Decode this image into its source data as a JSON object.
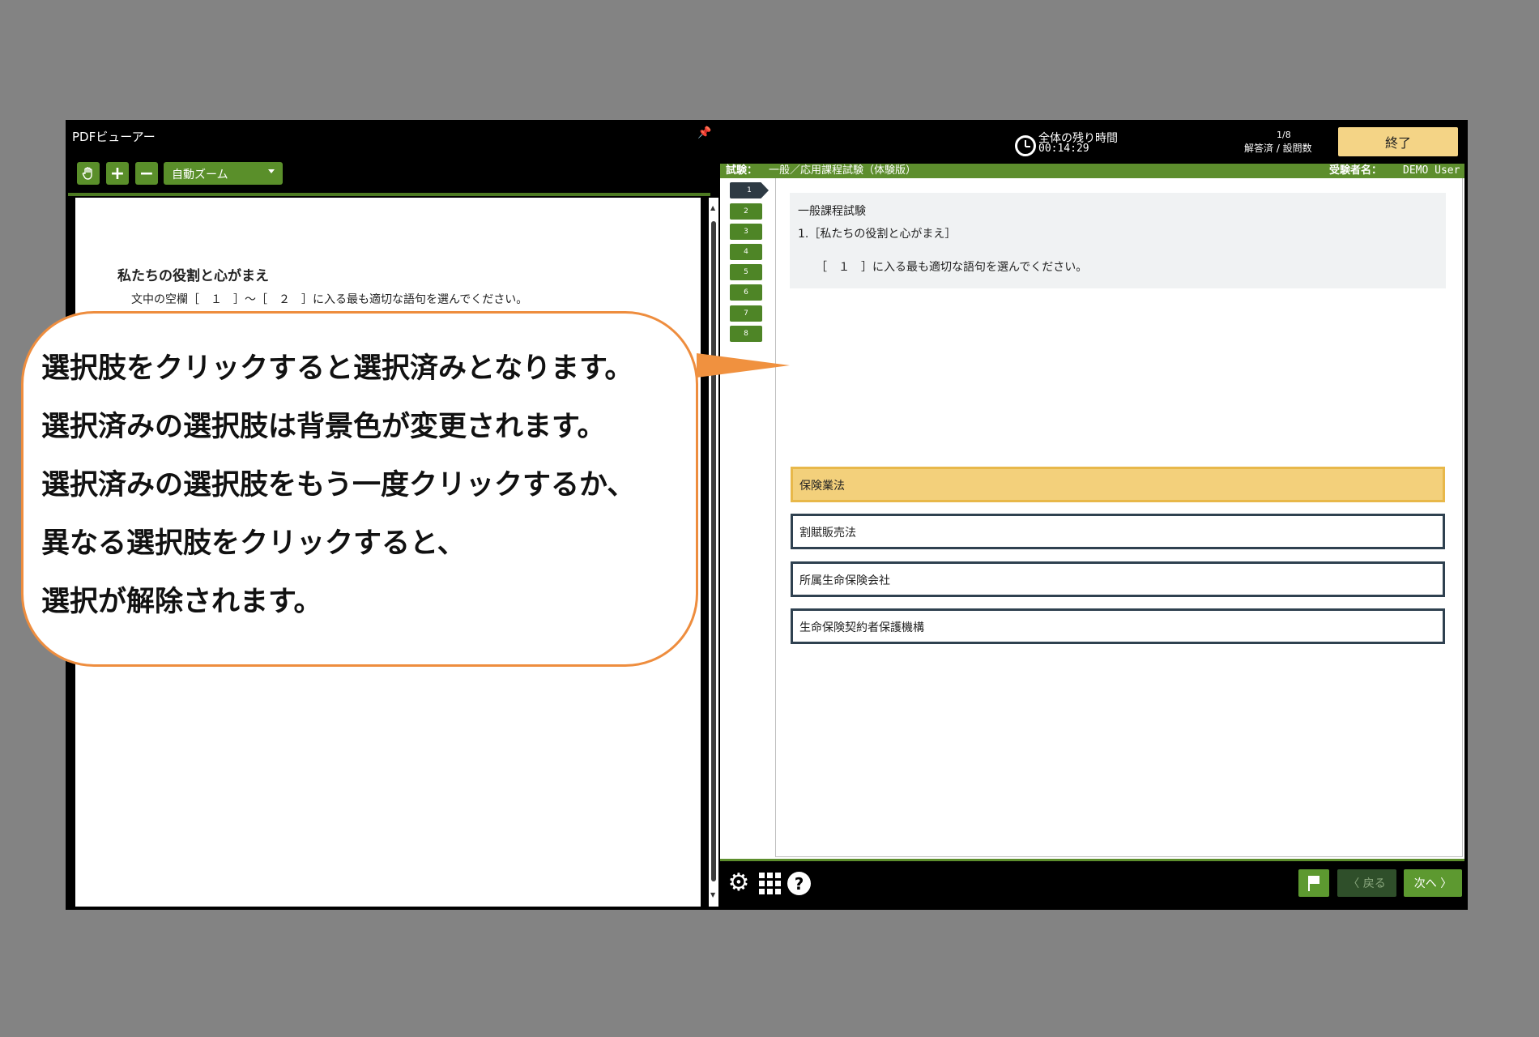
{
  "pdf_viewer": {
    "title": "PDFビューアー",
    "zoom_label": "自動ズーム",
    "doc_heading": "私たちの役割と心がまえ",
    "doc_body": "文中の空欄［　１　］～［　２　］に入る最も適切な語句を選んでください。"
  },
  "header": {
    "timer_label": "全体の残り時間",
    "timer_value": "00:14:29",
    "progress_count": "1/8",
    "progress_label": "解答済 / 設問数",
    "end_button": "終了"
  },
  "exam_bar": {
    "exam_key": "試験：",
    "exam_name": "一般／応用課程試験（体験版）",
    "candidate_key": "受験者名：",
    "candidate_name": "DEMO User"
  },
  "question_nav": {
    "items": [
      "1",
      "2",
      "3",
      "4",
      "5",
      "6",
      "7",
      "8"
    ],
    "current": 1
  },
  "question": {
    "category": "一般課程試験",
    "title": "1.［私たちの役割と心がまえ］",
    "text": "［　１　］に入る最も適切な語句を選んでください。"
  },
  "choices": [
    {
      "label": "保険業法",
      "selected": true
    },
    {
      "label": "割賦販売法",
      "selected": false
    },
    {
      "label": "所属生命保険会社",
      "selected": false
    },
    {
      "label": "生命保険契約者保護機構",
      "selected": false
    }
  ],
  "footer": {
    "back_label": "〈 戻る",
    "next_label": "次へ 〉"
  },
  "callout": {
    "lines": [
      "選択肢をクリックすると選択済みとなります。",
      "選択済みの選択肢は背景色が変更されます。",
      "選択済みの選択肢をもう一度クリックするか、",
      "異なる選択肢をクリックすると、",
      "選択が解除されます。"
    ]
  },
  "colors": {
    "accent_green": "#5d8e2d",
    "selected_choice": "#f3d07b",
    "callout_border": "#ee8d3e",
    "end_button": "#f4d486"
  }
}
